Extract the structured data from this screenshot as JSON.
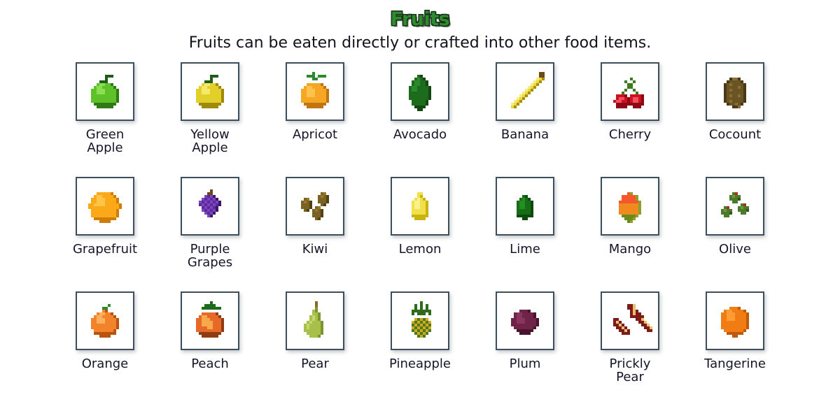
{
  "header": {
    "title": "Fruits",
    "subtitle": "Fruits can be eaten directly or crafted into other food items.",
    "title_color": "#2e8b2e",
    "title_outline_color": "#18321c",
    "subtitle_color": "#12121c"
  },
  "theme": {
    "background": "#ffffff",
    "box_border": "#3d4f5c",
    "box_fill": "#ffffff",
    "label_color": "#151528"
  },
  "gallery": {
    "columns": 7,
    "rows": 3,
    "items": [
      {
        "label": "Green\nApple",
        "icon": "green-apple-icon",
        "colors": {
          "main": "#5ec12a",
          "light": "#8ade52",
          "dark": "#2f7a14",
          "stem": "#1e5c18"
        }
      },
      {
        "label": "Yellow\nApple",
        "icon": "yellow-apple-icon",
        "colors": {
          "main": "#e3cf2a",
          "light": "#f4e96a",
          "dark": "#a08a0c",
          "stem": "#1e5c18"
        }
      },
      {
        "label": "Apricot",
        "icon": "apricot-icon",
        "colors": {
          "main": "#f5a623",
          "light": "#ffc24d",
          "dark": "#c07511",
          "stem": "#2c8a2c"
        }
      },
      {
        "label": "Avocado",
        "icon": "avocado-icon",
        "colors": {
          "main": "#1d6b1d",
          "light": "#2b8a2b",
          "dark": "#124712",
          "stem": "#124712"
        }
      },
      {
        "label": "Banana",
        "icon": "banana-icon",
        "colors": {
          "main": "#ecd83c",
          "light": "#f7ec7d",
          "dark": "#a8900f",
          "stem": "#6b4a16"
        }
      },
      {
        "label": "Cherry",
        "icon": "cherry-icon",
        "colors": {
          "main": "#cf1020",
          "light": "#f05060",
          "dark": "#8b0a14",
          "stem": "#3c7a20"
        }
      },
      {
        "label": "Cocount",
        "icon": "coconut-icon",
        "colors": {
          "main": "#6b5424",
          "light": "#8a6e33",
          "dark": "#4a3916",
          "stem": "#4a3916"
        }
      },
      {
        "label": "Grapefruit",
        "icon": "grapefruit-icon",
        "colors": {
          "main": "#fba919",
          "light": "#ffc548",
          "dark": "#d07d08",
          "stem": "#d07d08"
        }
      },
      {
        "label": "Purple\nGrapes",
        "icon": "purple-grapes-icon",
        "colors": {
          "main": "#5b2a97",
          "light": "#7b45c2",
          "dark": "#3a1866",
          "stem": "#6b4a16"
        }
      },
      {
        "label": "Kiwi",
        "icon": "kiwi-icon",
        "colors": {
          "main": "#7a6224",
          "light": "#96792f",
          "dark": "#53410f",
          "stem": "#53410f"
        }
      },
      {
        "label": "Lemon",
        "icon": "lemon-icon",
        "colors": {
          "main": "#f2e04a",
          "light": "#faf08c",
          "dark": "#c9b310",
          "stem": "#c9b310"
        }
      },
      {
        "label": "Lime",
        "icon": "lime-icon",
        "colors": {
          "main": "#166d16",
          "light": "#238f23",
          "dark": "#0c490c",
          "stem": "#0c490c"
        }
      },
      {
        "label": "Mango",
        "icon": "mango-icon",
        "colors": {
          "main": "#f08a20",
          "light": "#f5572a",
          "dark": "#8f9f2a",
          "stem": "#6b8a1e"
        }
      },
      {
        "label": "Olive",
        "icon": "olive-icon",
        "colors": {
          "main": "#4a7a2a",
          "light": "#6d9c3f",
          "dark": "#2f5718",
          "stem": "#b03020"
        }
      },
      {
        "label": "Orange",
        "icon": "orange-icon",
        "colors": {
          "main": "#f3832a",
          "light": "#ffb05c",
          "dark": "#b95310",
          "stem": "#2c8a2c"
        }
      },
      {
        "label": "Peach",
        "icon": "peach-icon",
        "colors": {
          "main": "#e8682a",
          "light": "#f7a84a",
          "dark": "#8e3d12",
          "stem": "#1e6b1e"
        }
      },
      {
        "label": "Pear",
        "icon": "pear-icon",
        "colors": {
          "main": "#a8c04a",
          "light": "#c2d870",
          "dark": "#7d9430",
          "stem": "#8a6a20"
        }
      },
      {
        "label": "Pineapple",
        "icon": "pineapple-icon",
        "colors": {
          "main": "#d6a81c",
          "light": "#efc93c",
          "dark": "#4a7a22",
          "stem": "#2f6b1c"
        }
      },
      {
        "label": "Plum",
        "icon": "plum-icon",
        "colors": {
          "main": "#6e2347",
          "light": "#8a3560",
          "dark": "#4a1430",
          "stem": "#4a1430"
        }
      },
      {
        "label": "Prickly\nPear",
        "icon": "prickly-pear-icon",
        "colors": {
          "main": "#7d1b18",
          "light": "#a32a22",
          "dark": "#5a0f0d",
          "stem": "#e8c070"
        }
      },
      {
        "label": "Tangerine",
        "icon": "tangerine-icon",
        "colors": {
          "main": "#f27c14",
          "light": "#ff9c33",
          "dark": "#c05a06",
          "stem": "#c05a06"
        }
      }
    ]
  }
}
